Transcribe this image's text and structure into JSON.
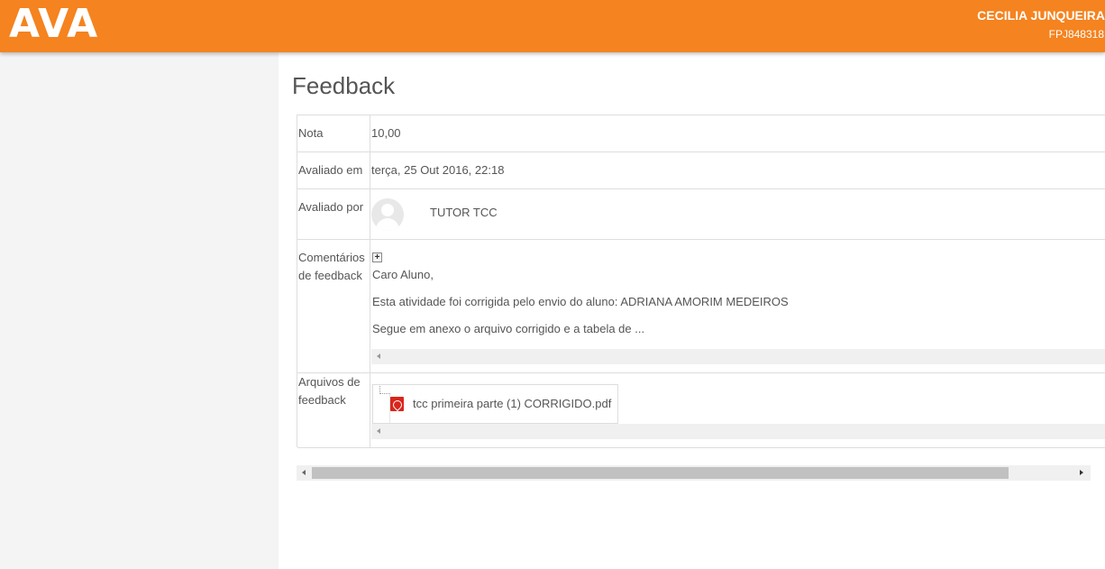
{
  "header": {
    "logo": "AVA",
    "user_name": "CECILIA JUNQUEIRA",
    "user_id": "FPJ848318",
    "color": "#f5831f"
  },
  "page": {
    "title": "Feedback"
  },
  "feedback": {
    "grade_label": "Nota",
    "grade_value": "10,00",
    "graded_on_label": "Avaliado em",
    "graded_on_value": "terça, 25 Out 2016, 22:18",
    "graded_by_label": "Avaliado por",
    "graded_by_value": "TUTOR TCC",
    "comments_label": "Comentários de feedback",
    "comments": [
      "Caro Aluno,",
      "Esta atividade foi corrigida pelo envio do aluno: ADRIANA AMORIM MEDEIROS",
      "Segue em anexo o arquivo corrigido e a tabela de ..."
    ],
    "files_label": "Arquivos de feedback",
    "files": [
      {
        "name": "tcc primeira parte (1) CORRIGIDO.pdf",
        "icon": "pdf-icon"
      }
    ]
  }
}
